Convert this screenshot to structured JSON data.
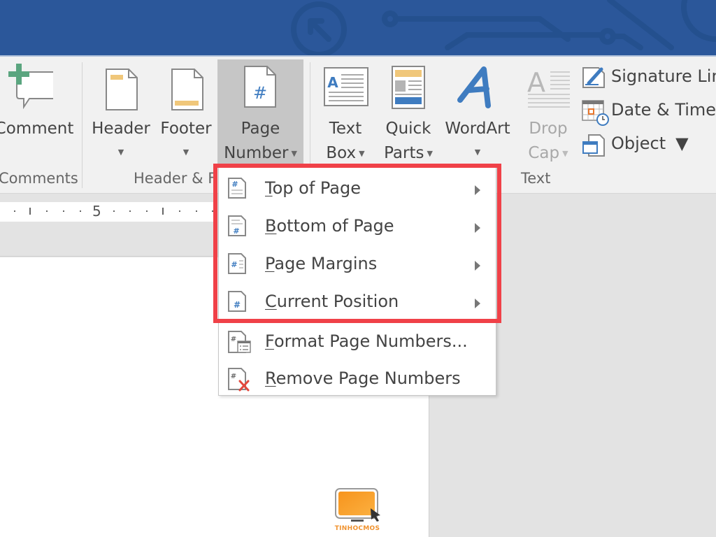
{
  "ribbon": {
    "comments_group": {
      "label": "Comments",
      "buttons": [
        {
          "label": "Comment",
          "icon": "new-comment-icon"
        }
      ]
    },
    "header_footer_group": {
      "label": "Header & F",
      "buttons": [
        {
          "label": "Header",
          "icon": "header-icon",
          "has_dropdown": true
        },
        {
          "label": "Footer",
          "icon": "footer-icon",
          "has_dropdown": true
        },
        {
          "label_line1": "Page",
          "label_line2": "Number",
          "icon": "page-number-icon",
          "has_dropdown": true,
          "pressed": true
        }
      ]
    },
    "text_group": {
      "label": "Text",
      "buttons": [
        {
          "label_line1": "Text",
          "label_line2": "Box",
          "icon": "text-box-icon",
          "has_dropdown": true
        },
        {
          "label_line1": "Quick",
          "label_line2": "Parts",
          "icon": "quick-parts-icon",
          "has_dropdown": true
        },
        {
          "label": "WordArt",
          "icon": "wordart-icon",
          "has_dropdown": true
        },
        {
          "label_line1": "Drop",
          "label_line2": "Cap",
          "icon": "drop-cap-icon",
          "has_dropdown": true,
          "disabled": true
        }
      ],
      "small_buttons": [
        {
          "label": "Signature Lin",
          "icon": "signature-line-icon"
        },
        {
          "label": "Date & Time",
          "icon": "date-time-icon"
        },
        {
          "label": "Object",
          "icon": "object-icon",
          "has_dropdown": true
        }
      ]
    }
  },
  "ruler": {
    "number": "5"
  },
  "page_number_menu": {
    "items": [
      {
        "label_access": "T",
        "label_rest": "op of Page",
        "icon": "top-of-page-icon",
        "submenu": true
      },
      {
        "label_access": "B",
        "label_rest": "ottom of Page",
        "icon": "bottom-of-page-icon",
        "submenu": true
      },
      {
        "label_access": "P",
        "label_rest": "age Margins",
        "icon": "page-margins-icon",
        "submenu": true
      },
      {
        "label_access": "C",
        "label_rest": "urrent Position",
        "icon": "current-position-icon",
        "submenu": true
      },
      {
        "label_access": "F",
        "label_rest": "ormat Page Numbers...",
        "icon": "format-page-numbers-icon",
        "submenu": false
      },
      {
        "label_access": "R",
        "label_rest": "emove Page Numbers",
        "icon": "remove-page-numbers-icon",
        "submenu": false
      }
    ],
    "highlight_color": "#f04148"
  },
  "colors": {
    "titlebar": "#2b579a",
    "ribbon_bg": "#f1f1f1",
    "accent_blue": "#3f7cc0",
    "accent_yellow": "#f0c77a",
    "accent_green": "#5aa57f"
  },
  "watermark": {
    "text": "TINHOCMOS"
  }
}
